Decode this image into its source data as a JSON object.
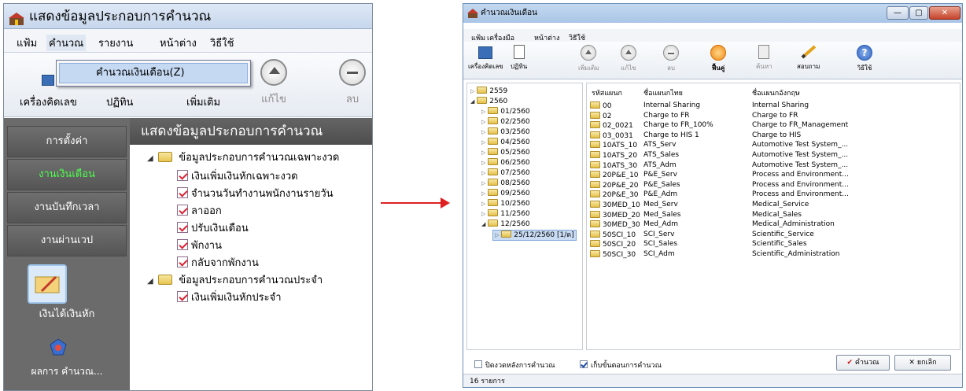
{
  "left": {
    "title": "แสดงข้อมูลประกอบการคำนวณ",
    "menu": [
      "แฟ้ม",
      "คำนวณ",
      "รายงาน",
      "หน้าต่าง",
      "วิธีใช้"
    ],
    "toolbar": {
      "calculator": "เครื่องคิดเลข",
      "calendar": "ปฏิทิน",
      "add": "เพิ่มเติม",
      "edit": "แก้ไข",
      "delete": "ลบ"
    },
    "dropdown_item": "คำนวณเงินเดือน(Z)",
    "nav": [
      "การตั้งค่า",
      "งานเงินเดือน",
      "งานบันทึกเวลา",
      "งานผ่านเวป",
      "เงินได้เงินหัก",
      "ผลการ คำนวณ..."
    ],
    "content_title": "แสดงข้อมูลประกอบการคำนวณ",
    "tree": {
      "group1": "ข้อมูลประกอบการคำนวณเฉพาะงวด",
      "group1_items": [
        "เงินเพิ่มเงินหักเฉพาะงวด",
        "จำนวนวันทำงานพนักงานรายวัน",
        "ลาออก",
        "ปรับเงินเดือน",
        "พักงาน",
        "กลับจากพักงาน"
      ],
      "group2": "ข้อมูลประกอบการคำนวณประจำ",
      "group2_items": [
        "เงินเพิ่มเงินหักประจำ"
      ]
    }
  },
  "right": {
    "title": "คำนวณเงินเดือน",
    "menu": [
      "แฟ้ม",
      "เครื่องมือ",
      "หน้าต่าง",
      "วิธีใช้"
    ],
    "toolbar": {
      "calculator": "เครื่องคิดเลข",
      "calendar": "ปฏิทิน",
      "add": "เพิ่มเติม",
      "edit": "แก้ไข",
      "delete": "ลบ",
      "restore": "ฟื้นคู่",
      "search": "ค้นหา",
      "ask": "สอบถาม",
      "help": "วิธีใช้"
    },
    "tree": {
      "years": [
        "2559",
        "2560"
      ],
      "months": [
        "01/2560",
        "02/2560",
        "03/2560",
        "04/2560",
        "05/2560",
        "06/2560",
        "07/2560",
        "08/2560",
        "09/2560",
        "10/2560",
        "11/2560",
        "12/2560"
      ],
      "selected": "25/12/2560 [1/ด]"
    },
    "columns": [
      "รหัสแผนก",
      "ชื่อแผนกไทย",
      "ชื่อแผนกอังกฤษ"
    ],
    "rows": [
      [
        "00",
        "Internal Sharing",
        "Internal Sharing"
      ],
      [
        "02",
        "Charge to FR",
        "Charge to FR"
      ],
      [
        "02_0021",
        "Charge to FR_100%",
        "Charge to FR_Management"
      ],
      [
        "03_0031",
        "Charge to HIS 1",
        "Charge to HIS"
      ],
      [
        "10ATS_10",
        "ATS_Serv",
        "Automotive Test System_..."
      ],
      [
        "10ATS_20",
        "ATS_Sales",
        "Automotive Test System_..."
      ],
      [
        "10ATS_30",
        "ATS_Adm",
        "Automotive Test System_..."
      ],
      [
        "20P&E_10",
        "P&E_Serv",
        "Process and Environment..."
      ],
      [
        "20P&E_20",
        "P&E_Sales",
        "Process and Environment..."
      ],
      [
        "20P&E_30",
        "P&E_Adm",
        "Process and Environment..."
      ],
      [
        "30MED_10",
        "Med_Serv",
        "Medical_Service"
      ],
      [
        "30MED_20",
        "Med_Sales",
        "Medical_Sales"
      ],
      [
        "30MED_30",
        "Med_Adm",
        "Medical_Administration"
      ],
      [
        "50SCI_10",
        "SCI_Serv",
        "Scientific_Service"
      ],
      [
        "50SCI_20",
        "SCI_Sales",
        "Scientific_Sales"
      ],
      [
        "50SCI_30",
        "SCI_Adm",
        "Scientific_Administration"
      ]
    ],
    "check1": "ปิดงวดหลังการคำนวณ",
    "check2": "เก็บขั้นตอนการคำนวณ",
    "ok_label": "คำนวณ",
    "cancel_label": "ยกเลิก",
    "status": "16 รายการ"
  },
  "colors": {
    "arrow": "#e02020",
    "nav_active": "#4dff4d",
    "nav_bg": "#6b6b6b"
  }
}
